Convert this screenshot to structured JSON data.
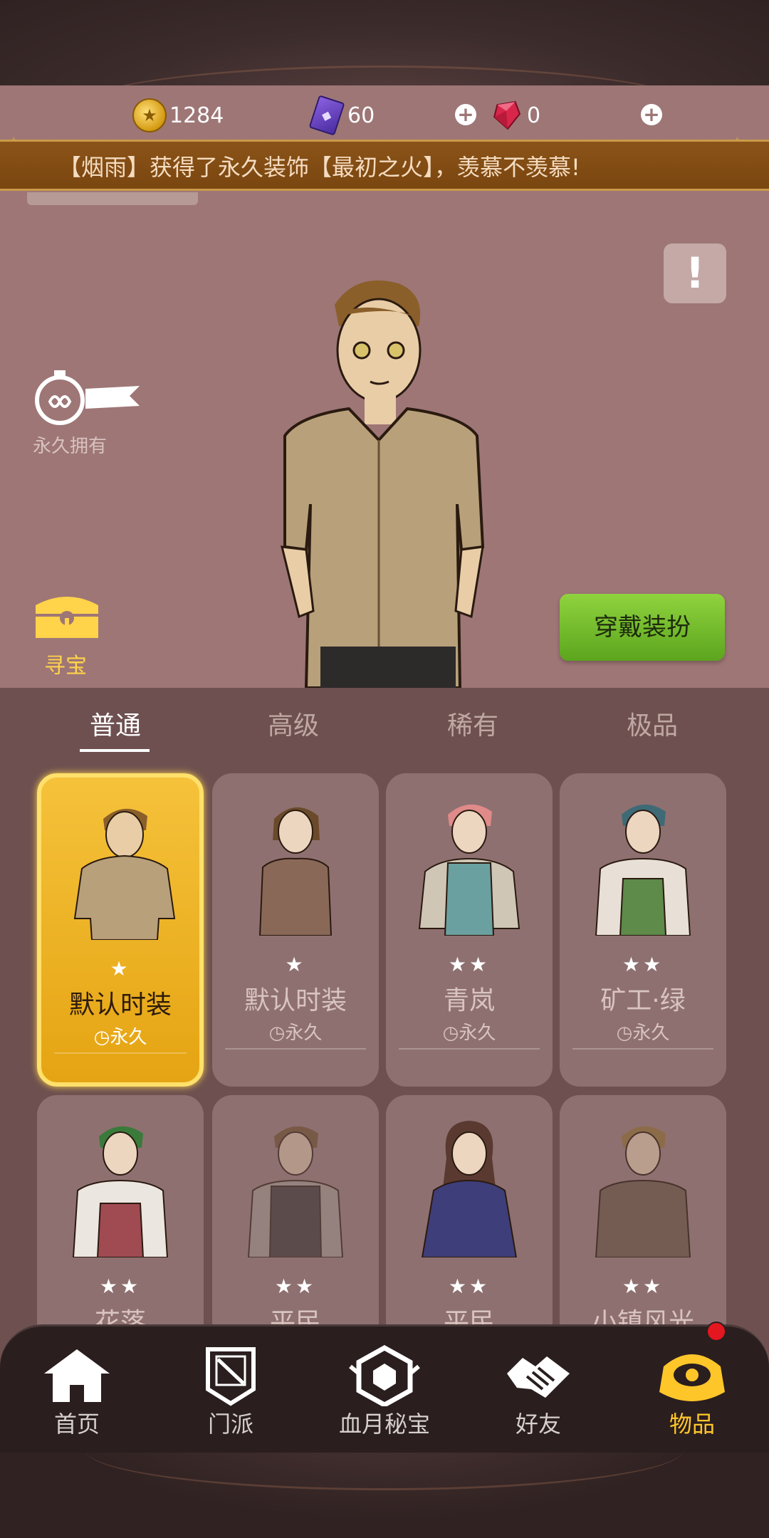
{
  "currency": {
    "coins": "1284",
    "cards": "60",
    "gems": "0"
  },
  "banner": "【烟雨】获得了永久装饰【最初之火】，羡慕不羡慕!",
  "alert": "!",
  "permanent_label": "永久拥有",
  "treasure_label": "寻宝",
  "wear_button": "穿戴装扮",
  "tabs": [
    "普通",
    "高级",
    "稀有",
    "极品"
  ],
  "items": [
    {
      "name": "默认时装",
      "stars": "★",
      "duration": "永久"
    },
    {
      "name": "默认时装",
      "stars": "★",
      "duration": "永久"
    },
    {
      "name": "青岚",
      "stars": "★★",
      "duration": "永久"
    },
    {
      "name": "矿工·绿",
      "stars": "★★",
      "duration": "永久"
    },
    {
      "name": "花落",
      "stars": "★★",
      "duration": ""
    },
    {
      "name": "平民",
      "stars": "★★",
      "duration": ""
    },
    {
      "name": "平民",
      "stars": "★★",
      "duration": ""
    },
    {
      "name": "小镇风光",
      "stars": "★★",
      "duration": ""
    }
  ],
  "nav": [
    "首页",
    "门派",
    "血月秘宝",
    "好友",
    "物品"
  ],
  "colors": {
    "accent": "#ffc62a",
    "stage_bg": "#9e7676",
    "panel_bg": "#6e5050",
    "wear_button": "#7cc22e",
    "banner_bg": "#7a4610"
  }
}
